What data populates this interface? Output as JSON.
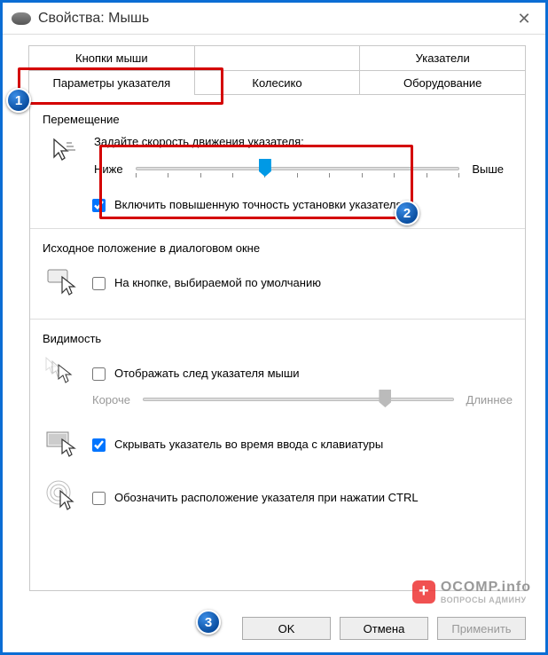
{
  "window": {
    "title": "Свойства: Мышь"
  },
  "tabs": {
    "row1": [
      "Кнопки мыши",
      "",
      "Указатели"
    ],
    "row2": [
      "Параметры указателя",
      "Колесико",
      "Оборудование"
    ],
    "active": "Параметры указателя"
  },
  "movement": {
    "group_label": "Перемещение",
    "speed_label": "Задайте скорость движения указателя:",
    "slow_label": "Ниже",
    "fast_label": "Выше",
    "slider_value": 5,
    "slider_max": 10,
    "enhance_precision": {
      "label": "Включить повышенную точность установки указателя",
      "checked": true
    }
  },
  "snap": {
    "group_label": "Исходное положение в диалоговом окне",
    "default_button": {
      "label": "На кнопке, выбираемой по умолчанию",
      "checked": false
    }
  },
  "visibility": {
    "group_label": "Видимость",
    "trails": {
      "label": "Отображать след указателя мыши",
      "checked": false,
      "short": "Короче",
      "long": "Длиннее",
      "slider_value": 8,
      "slider_max": 10
    },
    "hide_typing": {
      "label": "Скрывать указатель во время ввода с клавиатуры",
      "checked": true
    },
    "ctrl_locate": {
      "label": "Обозначить расположение указателя при нажатии CTRL",
      "checked": false
    }
  },
  "buttons": {
    "ok": "OK",
    "cancel": "Отмена",
    "apply": "Применить"
  },
  "annotations": {
    "1": "1",
    "2": "2",
    "3": "3"
  },
  "watermark": {
    "top": "OCOMP.info",
    "bot": "ВОПРОСЫ АДМИНУ"
  }
}
